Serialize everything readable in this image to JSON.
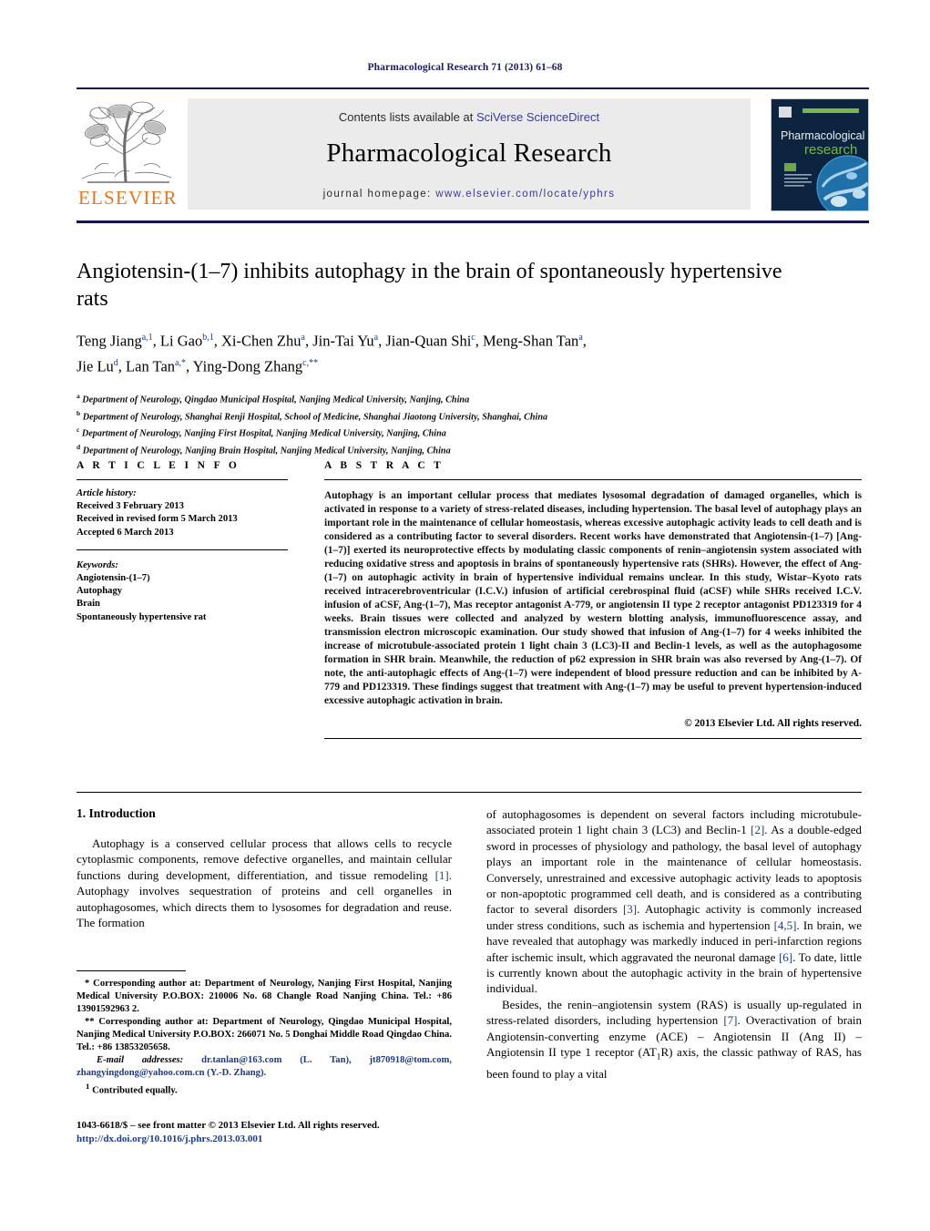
{
  "running_head": "Pharmacological Research 71 (2013) 61–68",
  "masthead": {
    "contents_prefix": "Contents lists available at ",
    "sciencedirect": "SciVerse ScienceDirect",
    "journal_title": "Pharmacological Research",
    "homepage_label": "journal homepage:",
    "homepage_url": "www.elsevier.com/locate/yphrs",
    "publisher_logo_text": "ELSEVIER",
    "cover_title_line1": "Pharmacological",
    "cover_title_line2": "research",
    "colors": {
      "link": "#3a3a9c",
      "elsevier_orange": "#e87722",
      "masthead_band": "#ebebeb",
      "rule_navy": "#16164a",
      "cover_bg": "#0d2440",
      "cover_green": "#7ab648"
    }
  },
  "article": {
    "title": "Angiotensin-(1–7) inhibits autophagy in the brain of spontaneously hypertensive rats",
    "authors_line1": "Teng Jiang<sup>a,1</sup>, Li Gao<sup>b,1</sup>, Xi-Chen Zhu<sup>a</sup>, Jin-Tai Yu<sup>a</sup>, Jian-Quan Shi<sup>c</sup>, Meng-Shan Tan<sup>a</sup>,",
    "authors_line2": "Jie Lu<sup>d</sup>, Lan Tan<sup>a,*</sup>, Ying-Dong Zhang<sup>c,**</sup>",
    "affiliations": [
      "<sup>a</sup> Department of Neurology, Qingdao Municipal Hospital, Nanjing Medical University, Nanjing, China",
      "<sup>b</sup> Department of Neurology, Shanghai Renji Hospital, School of Medicine, Shanghai Jiaotong University, Shanghai, China",
      "<sup>c</sup> Department of Neurology, Nanjing First Hospital, Nanjing Medical University, Nanjing, China",
      "<sup>d</sup> Department of Neurology, Nanjing Brain Hospital, Nanjing Medical University, Nanjing, China"
    ]
  },
  "article_info": {
    "heading": "A R T I C L E    I N F O",
    "history_label": "Article history:",
    "history": [
      "Received 3 February 2013",
      "Received in revised form 5 March 2013",
      "Accepted 6 March 2013"
    ],
    "keywords_label": "Keywords:",
    "keywords": [
      "Angiotensin-(1–7)",
      "Autophagy",
      "Brain",
      "Spontaneously hypertensive rat"
    ]
  },
  "abstract": {
    "heading": "A B S T R A C T",
    "text": "Autophagy is an important cellular process that mediates lysosomal degradation of damaged organelles, which is activated in response to a variety of stress-related diseases, including hypertension. The basal level of autophagy plays an important role in the maintenance of cellular homeostasis, whereas excessive autophagic activity leads to cell death and is considered as a contributing factor to several disorders. Recent works have demonstrated that Angiotensin-(1–7) [Ang-(1–7)] exerted its neuroprotective effects by modulating classic components of renin–angiotensin system associated with reducing oxidative stress and apoptosis in brains of spontaneously hypertensive rats (SHRs). However, the effect of Ang-(1–7) on autophagic activity in brain of hypertensive individual remains unclear. In this study, Wistar–Kyoto rats received intracerebroventricular (I.C.V.) infusion of artificial cerebrospinal fluid (aCSF) while SHRs received I.C.V. infusion of aCSF, Ang-(1–7), Mas receptor antagonist A-779, or angiotensin II type 2 receptor antagonist PD123319 for 4 weeks. Brain tissues were collected and analyzed by western blotting analysis, immunofluorescence assay, and transmission electron microscopic examination. Our study showed that infusion of Ang-(1–7) for 4 weeks inhibited the increase of microtubule-associated protein 1 light chain 3 (LC3)-II and Beclin-1 levels, as well as the autophagosome formation in SHR brain. Meanwhile, the reduction of p62 expression in SHR brain was also reversed by Ang-(1–7). Of note, the anti-autophagic effects of Ang-(1–7) were independent of blood pressure reduction and can be inhibited by A-779 and PD123319. These findings suggest that treatment with Ang-(1–7) may be useful to prevent hypertension-induced excessive autophagic activation in brain.",
    "copyright": "© 2013 Elsevier Ltd. All rights reserved."
  },
  "body": {
    "section_heading": "1.  Introduction",
    "left_paragraph": "Autophagy is a conserved cellular process that allows cells to recycle cytoplasmic components, remove defective organelles, and maintain cellular functions during development, differentiation, and tissue remodeling [1]. Autophagy involves sequestration of proteins and cell organelles in autophagosomes, which directs them to lysosomes for degradation and reuse. The formation",
    "right_paragraph_1": "of autophagosomes is dependent on several factors including microtubule-associated protein 1 light chain 3 (LC3) and Beclin-1 [2]. As a double-edged sword in processes of physiology and pathology, the basal level of autophagy plays an important role in the maintenance of cellular homeostasis. Conversely, unrestrained and excessive autophagic activity leads to apoptosis or non-apoptotic programmed cell death, and is considered as a contributing factor to several disorders [3]. Autophagic activity is commonly increased under stress conditions, such as ischemia and hypertension [4,5]. In brain, we have revealed that autophagy was markedly induced in peri-infarction regions after ischemic insult, which aggravated the neuronal damage [6]. To date, little is currently known about the autophagic activity in the brain of hypertensive individual.",
    "right_paragraph_2": "Besides, the renin–angiotensin system (RAS) is usually up-regulated in stress-related disorders, including hypertension [7]. Overactivation of brain Angiotensin-converting enzyme (ACE) – Angiotensin II (Ang II) – Angiotensin II type 1 receptor (AT<sub>1</sub>R) axis, the classic pathway of RAS, has been found to play a vital"
  },
  "footnotes": {
    "corresponding_1": "* Corresponding author at: Department of Neurology, Nanjing First Hospital, Nanjing Medical University P.O.BOX: 210006 No. 68 Changle Road Nanjing China. Tel.: +86 13901592963 2.",
    "corresponding_2": "** Corresponding author at: Department of Neurology, Qingdao Municipal Hospital, Nanjing Medical University P.O.BOX: 266071 No. 5 Donghai Middle Road Qingdao China. Tel.: +86 13853205658.",
    "email_label": "E-mail addresses:",
    "emails": "dr.tanlan@163.com (L. Tan), jt870918@tom.com, zhangyingdong@yahoo.com.cn (Y.-D. Zhang).",
    "contributed": "1  Contributed equally."
  },
  "imprint": {
    "line1": "1043-6618/$ – see front matter © 2013 Elsevier Ltd. All rights reserved.",
    "doi": "http://dx.doi.org/10.1016/j.phrs.2013.03.001"
  }
}
